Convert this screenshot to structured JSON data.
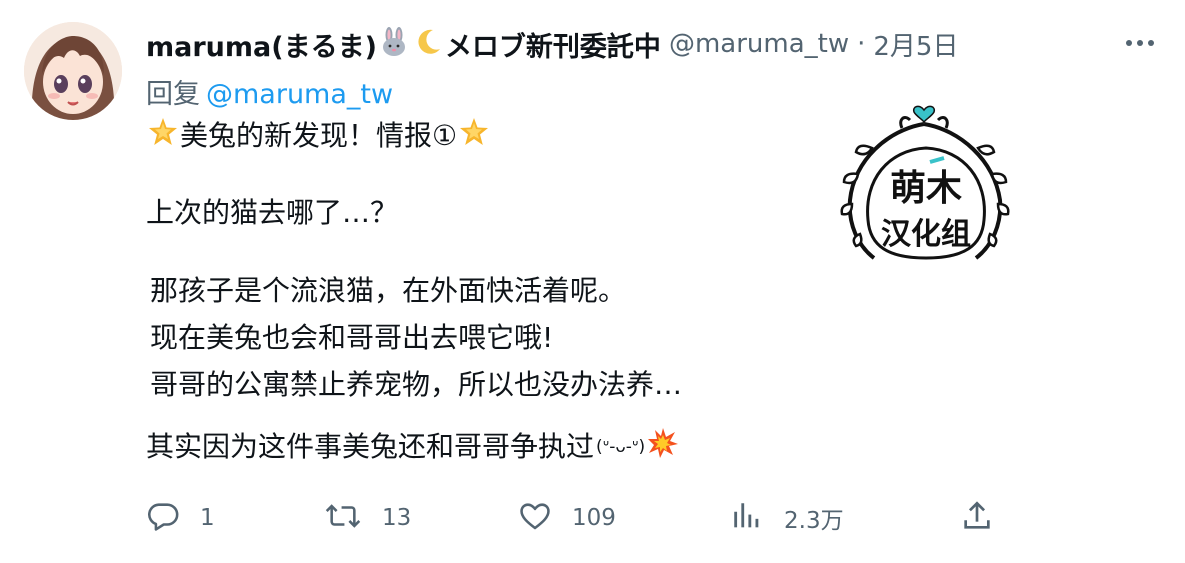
{
  "tweet": {
    "author_name": "maruma(まるま)",
    "author_suffix": "メロブ新刊委託中",
    "author_emoji": [
      "rabbit-emoji",
      "crescent-moon-emoji"
    ],
    "handle": "@maruma_tw",
    "separator": "·",
    "date": "2月5日",
    "reply_prefix": "回复",
    "reply_mention": "@maruma_tw",
    "lines": [
      "美兔的新发现！情报①",
      "上次的猫去哪了…？",
      "那孩子是个流浪猫，在外面快活着呢。",
      "现在美兔也会和哥哥出去喂它哦!",
      "哥哥的公寓禁止养宠物，所以也没办法养…",
      "其实因为这件事美兔还和哥哥争执过",
      "(ᐡ-ᴗ-ᐡ)"
    ],
    "line_emoji": [
      "glowing-star-emoji",
      "glowing-star-emoji",
      "collision-emoji"
    ],
    "sticker_text_top": "萌木",
    "sticker_text_bottom": "汉化组",
    "accent": "#1d9bf0",
    "muted": "#536471"
  },
  "actions": {
    "reply_count": "1",
    "retweet_count": "13",
    "like_count": "109",
    "views_count": "2.3万"
  }
}
